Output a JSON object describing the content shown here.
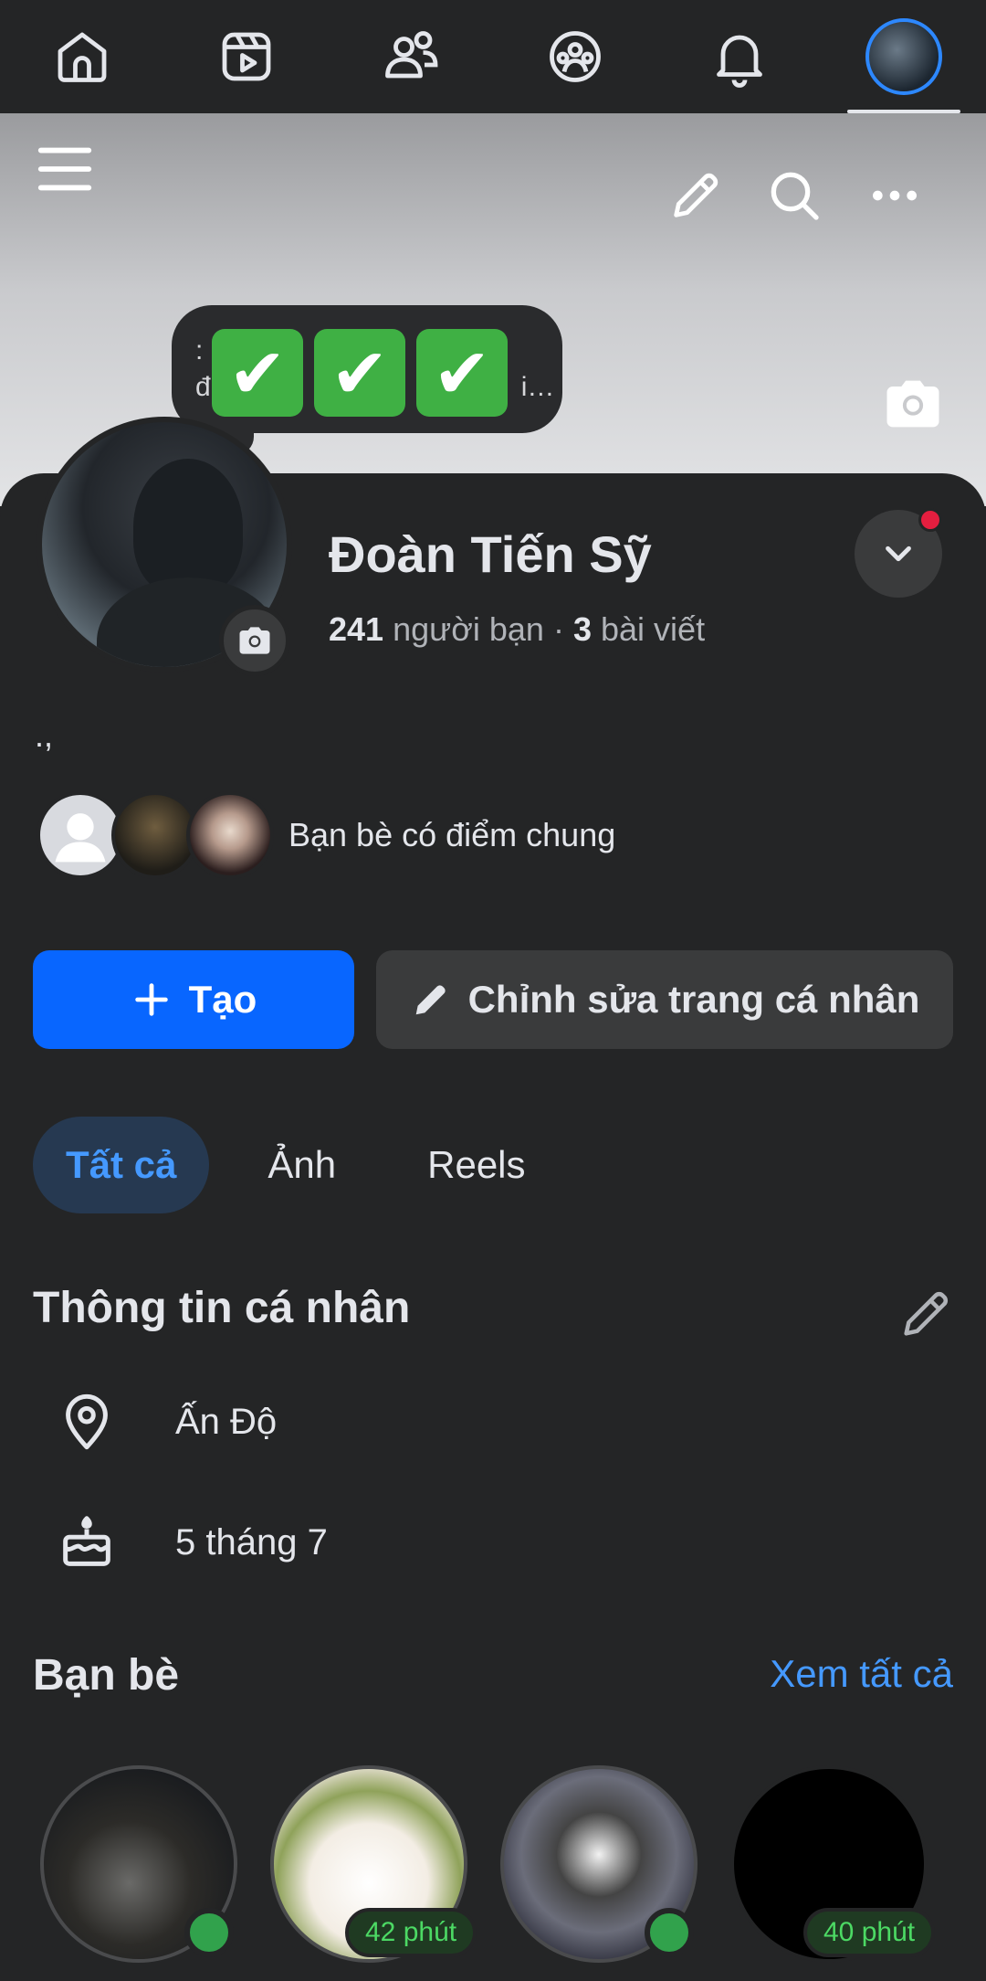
{
  "status": {
    "text_line1": ":",
    "text_line2": "đ",
    "text_tail": "i…",
    "checks": [
      "✔",
      "✔",
      "✔"
    ]
  },
  "profile": {
    "name": "Đoàn Tiến Sỹ",
    "friends_count": "241",
    "friends_label": "người bạn",
    "separator": "·",
    "posts_count": "3",
    "posts_label": "bài viết",
    "bio": ".,"
  },
  "mutual": {
    "label": "Bạn bè có điểm chung"
  },
  "actions": {
    "create_label": "Tạo",
    "edit_label": "Chỉnh sửa trang cá nhân"
  },
  "tabs": [
    {
      "label": "Tất cả",
      "active": true
    },
    {
      "label": "Ảnh",
      "active": false
    },
    {
      "label": "Reels",
      "active": false
    }
  ],
  "about": {
    "title": "Thông tin cá nhân",
    "location": "Ấn Độ",
    "birthday": "5 tháng 7"
  },
  "friends_section": {
    "title": "Bạn bè",
    "see_all": "Xem tất cả",
    "items": [
      {
        "status": "online"
      },
      {
        "status": "42 phút"
      },
      {
        "status": "online"
      },
      {
        "status": "40 phút"
      }
    ]
  },
  "colors": {
    "accent": "#0866ff",
    "link": "#4599ff",
    "online": "#31a24c",
    "background": "#242526"
  },
  "icons": {
    "nav": [
      "home-icon",
      "reels-icon",
      "friends-icon",
      "groups-icon",
      "bell-icon",
      "profile-avatar"
    ],
    "cover": [
      "menu-icon",
      "pencil-icon",
      "search-icon",
      "more-icon",
      "camera-icon"
    ]
  }
}
